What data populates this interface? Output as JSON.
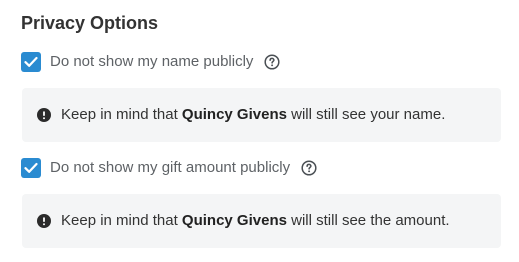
{
  "privacy": {
    "title": "Privacy Options",
    "options": [
      {
        "label": "Do not show my name publicly",
        "checked": true,
        "notice": {
          "prefix": "Keep in mind that ",
          "name": "Quincy Givens",
          "suffix": " will still see your name."
        }
      },
      {
        "label": "Do not show my gift amount publicly",
        "checked": true,
        "notice": {
          "prefix": "Keep in mind that ",
          "name": "Quincy Givens",
          "suffix": " will still see the amount."
        }
      }
    ]
  },
  "icons": {
    "checkbox": "checkmark-icon",
    "help": "question-circle-icon",
    "notice": "exclamation-circle-icon"
  },
  "colors": {
    "checkbox_fill": "#2a8bd1",
    "notice_background": "#f4f5f6",
    "title_text": "#333333",
    "label_text": "#5e6266"
  }
}
